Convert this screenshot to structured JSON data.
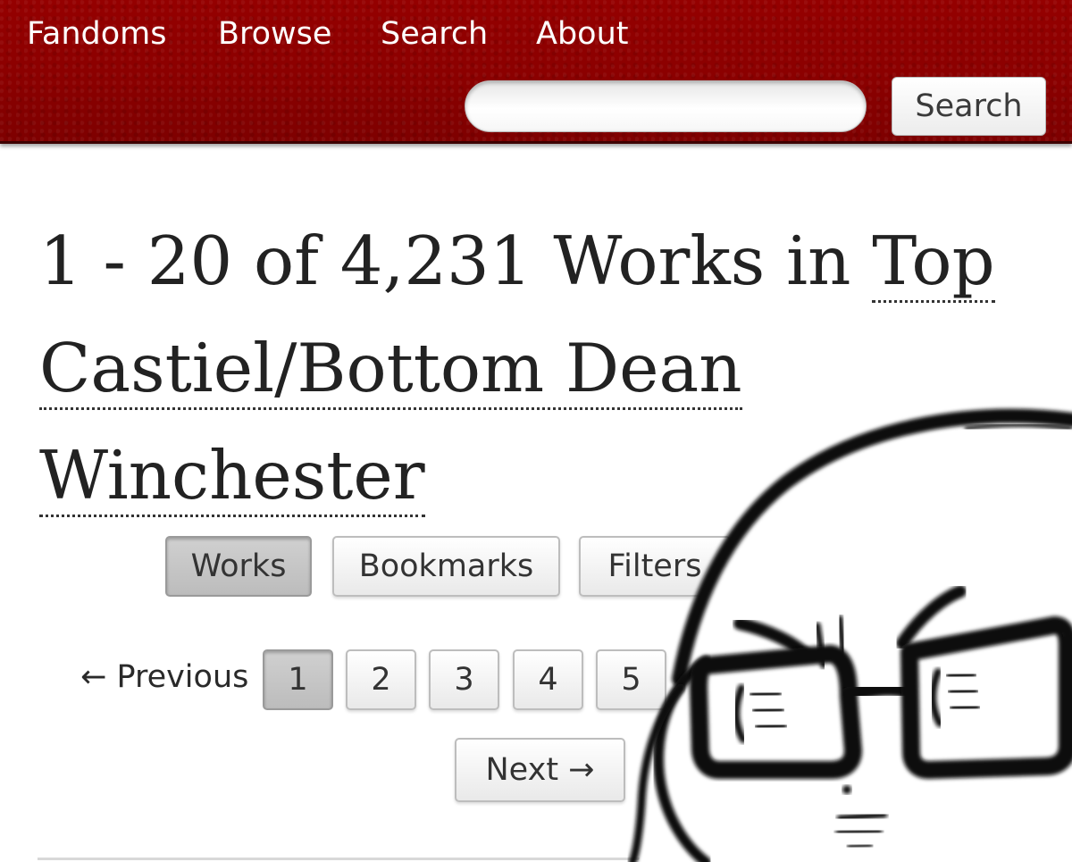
{
  "header": {
    "nav": [
      "Fandoms",
      "Browse",
      "Search",
      "About"
    ],
    "search_placeholder": "",
    "search_button": "Search"
  },
  "heading": {
    "count_text": "1 - 20 of 4,231 Works in ",
    "tag": "Top Castiel/Bottom Dean Winchester"
  },
  "tabs": [
    {
      "label": "Works",
      "current": true
    },
    {
      "label": "Bookmarks",
      "current": false
    },
    {
      "label": "Filters",
      "current": false
    }
  ],
  "pagination": {
    "previous": "← Previous",
    "pages": [
      "1",
      "2",
      "3",
      "4",
      "5"
    ],
    "current_page": "1",
    "next": "Next →"
  },
  "colors": {
    "header_red": "#8a0000",
    "text": "#2a2a2a"
  },
  "overlay_icon": "glasses-face-doodle-icon"
}
